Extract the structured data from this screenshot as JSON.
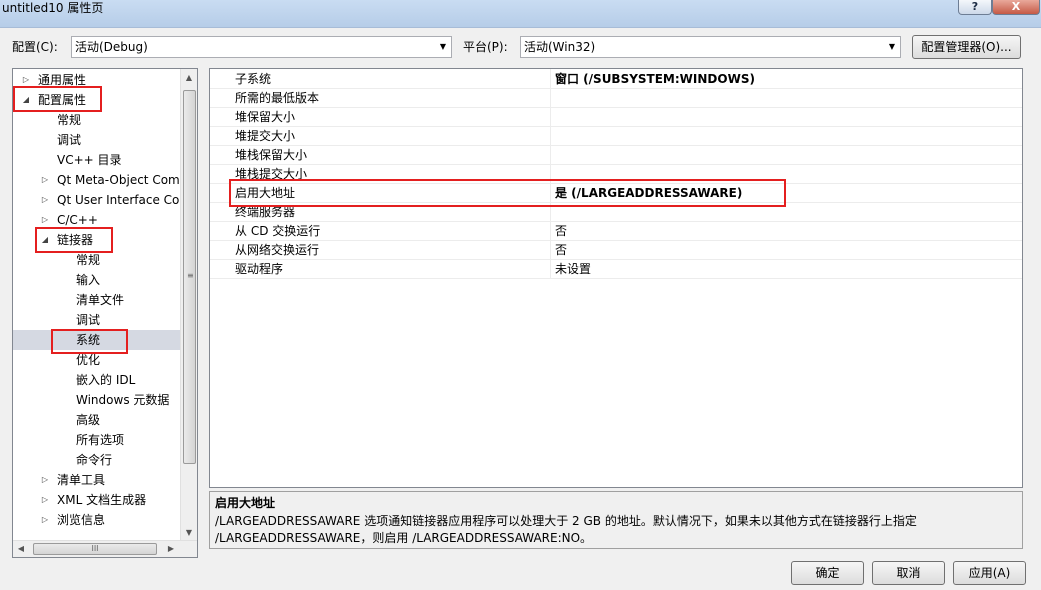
{
  "window": {
    "title": "untitled10 属性页",
    "help_label": "?",
    "close_label": "X"
  },
  "toolbar": {
    "config_label": "配置(C):",
    "config_value": "活动(Debug)",
    "platform_label": "平台(P):",
    "platform_value": "活动(Win32)",
    "config_manager_label": "配置管理器(O)..."
  },
  "tree": {
    "items": [
      {
        "label": "通用属性",
        "expander": "collapsed"
      },
      {
        "label": "配置属性",
        "expander": "expanded"
      },
      {
        "label": "常规",
        "expander": "none"
      },
      {
        "label": "调试",
        "expander": "none"
      },
      {
        "label": "VC++ 目录",
        "expander": "none"
      },
      {
        "label": "Qt Meta-Object Com",
        "expander": "collapsed"
      },
      {
        "label": "Qt User Interface Co",
        "expander": "collapsed"
      },
      {
        "label": "C/C++",
        "expander": "collapsed"
      },
      {
        "label": "链接器",
        "expander": "expanded"
      },
      {
        "label": "常规",
        "expander": "none"
      },
      {
        "label": "输入",
        "expander": "none"
      },
      {
        "label": "清单文件",
        "expander": "none"
      },
      {
        "label": "调试",
        "expander": "none"
      },
      {
        "label": "系统",
        "expander": "none",
        "selected": true
      },
      {
        "label": "优化",
        "expander": "none"
      },
      {
        "label": "嵌入的 IDL",
        "expander": "none"
      },
      {
        "label": "Windows 元数据",
        "expander": "none"
      },
      {
        "label": "高级",
        "expander": "none"
      },
      {
        "label": "所有选项",
        "expander": "none"
      },
      {
        "label": "命令行",
        "expander": "none"
      },
      {
        "label": "清单工具",
        "expander": "collapsed"
      },
      {
        "label": "XML 文档生成器",
        "expander": "collapsed"
      },
      {
        "label": "浏览信息",
        "expander": "collapsed"
      }
    ],
    "scroll_grip": "≡",
    "hscroll_grip": "III"
  },
  "properties": {
    "rows": [
      {
        "name": "子系统",
        "value": "窗口 (/SUBSYSTEM:WINDOWS)",
        "bold": true
      },
      {
        "name": "所需的最低版本",
        "value": ""
      },
      {
        "name": "堆保留大小",
        "value": ""
      },
      {
        "name": "堆提交大小",
        "value": ""
      },
      {
        "name": "堆栈保留大小",
        "value": ""
      },
      {
        "name": "堆栈提交大小",
        "value": ""
      },
      {
        "name": "启用大地址",
        "value": "是 (/LARGEADDRESSAWARE)",
        "bold": true
      },
      {
        "name": "终端服务器",
        "value": ""
      },
      {
        "name": "从 CD 交换运行",
        "value": "否"
      },
      {
        "name": "从网络交换运行",
        "value": "否"
      },
      {
        "name": "驱动程序",
        "value": "未设置"
      }
    ]
  },
  "description": {
    "title": "启用大地址",
    "line1": "/LARGEADDRESSAWARE 选项通知链接器应用程序可以处理大于 2 GB 的地址。默认情况下，如果未以其他方式在链接器行上指定",
    "line2": "/LARGEADDRESSAWARE，则启用 /LARGEADDRESSAWARE:NO。"
  },
  "footer": {
    "ok_label": "确定",
    "cancel_label": "取消",
    "apply_label": "应用(A)"
  },
  "colors": {
    "highlight": "#e41f1f",
    "selection": "#d5d9e2"
  }
}
